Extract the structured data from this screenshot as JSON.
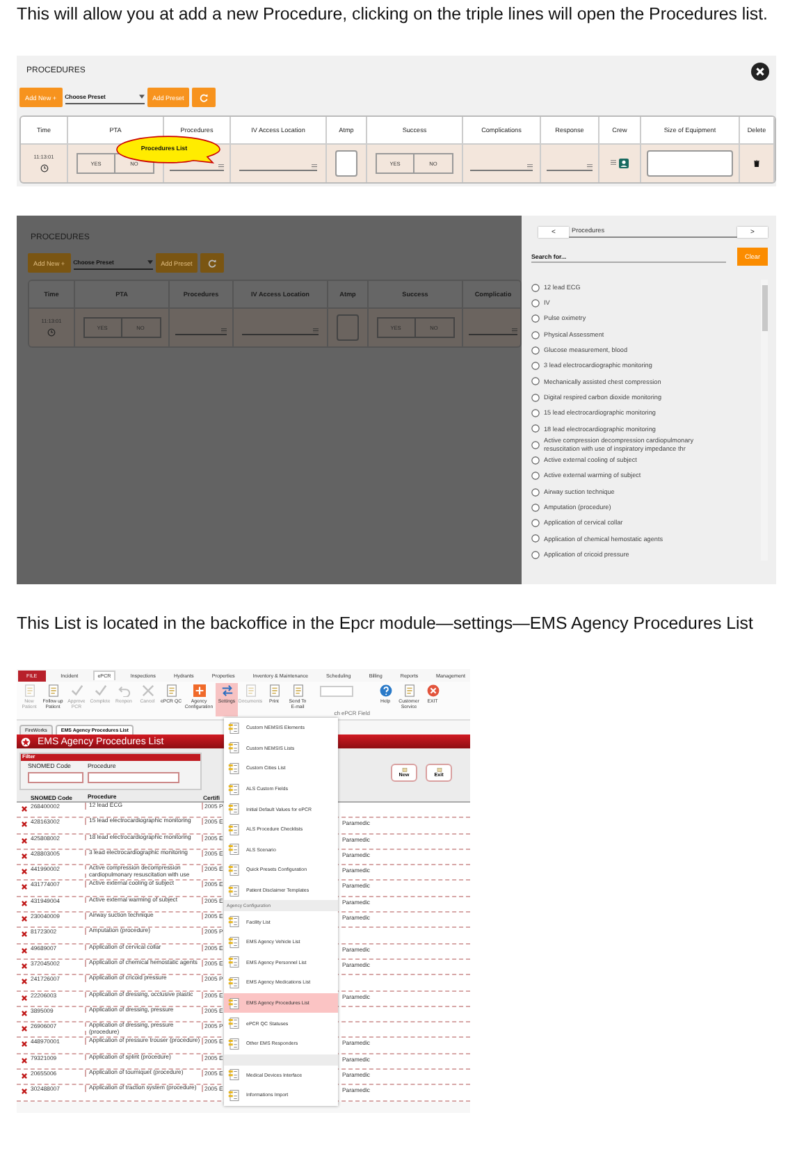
{
  "intro_text": "This will allow you at add a new Procedure, clicking on the triple lines will open the Procedures list.",
  "procedures_form": {
    "title": "PROCEDURES",
    "add_new": "Add New +",
    "preset_placeholder": "Choose Preset",
    "add_preset": "Add Preset",
    "callout": "Procedures List",
    "columns": [
      "Time",
      "PTA",
      "Procedures",
      "IV Access Location",
      "Atmp",
      "Success",
      "Complications",
      "Response",
      "Crew",
      "Size of Equipment",
      "Delete"
    ],
    "row": [
      {
        "kind": "time",
        "text": "11:13:01"
      },
      {
        "kind": "toggle",
        "yes": "YES",
        "no": "NO"
      },
      {
        "kind": "lookup"
      },
      {
        "kind": "lookup"
      },
      {
        "kind": "box"
      },
      {
        "kind": "toggle",
        "yes": "YES",
        "no": "NO"
      },
      {
        "kind": "lookup"
      },
      {
        "kind": "lookup"
      },
      {
        "kind": "crew"
      },
      {
        "kind": "box"
      },
      {
        "kind": "delete"
      }
    ]
  },
  "dimmed_form": {
    "title": "PROCEDURES",
    "add_new": "Add New +",
    "preset_placeholder": "Choose Preset",
    "add_preset": "Add Preset",
    "columns": [
      "Time",
      "PTA",
      "Procedures",
      "IV Access Location",
      "Atmp",
      "Success",
      "Complicatio"
    ],
    "row": [
      {
        "kind": "time",
        "text": "11:13:01"
      },
      {
        "kind": "toggle",
        "yes": "YES",
        "no": "NO"
      },
      {
        "kind": "lookup"
      },
      {
        "kind": "lookup"
      },
      {
        "kind": "box"
      },
      {
        "kind": "toggle",
        "yes": "YES",
        "no": "NO"
      },
      {
        "kind": "lookup"
      }
    ]
  },
  "procedures_picker": {
    "title": "Procedures",
    "prev": "<",
    "next": ">",
    "search_placeholder": "Search for...",
    "clear": "Clear",
    "items": [
      {
        "label": "12 lead ECG",
        "selected": false
      },
      {
        "label": "IV",
        "selected": false
      },
      {
        "label": "Pulse oximetry",
        "selected": false
      },
      {
        "label": "Physical Assessment",
        "selected": false
      },
      {
        "label": "Glucose measurement, blood",
        "selected": false
      },
      {
        "label": "3 lead electrocardiographic monitoring",
        "selected": false
      },
      {
        "label": "Mechanically assisted chest compression",
        "selected": false
      },
      {
        "label": "Digital respired carbon dioxide monitoring",
        "selected": false
      },
      {
        "label": "15 lead electrocardiographic monitoring",
        "selected": false
      },
      {
        "label": "18 lead electrocardiographic monitoring",
        "selected": false
      },
      {
        "label": "Active compression decompression cardiopulmonary resuscitation with use of inspiratory impedance thr",
        "selected": false
      },
      {
        "label": "Active external cooling of subject",
        "selected": false
      },
      {
        "label": "Active external warming of subject",
        "selected": false
      },
      {
        "label": "Airway suction technique",
        "selected": false
      },
      {
        "label": "Amputation (procedure)",
        "selected": false
      },
      {
        "label": "Application of cervical collar",
        "selected": false
      },
      {
        "label": "Application of chemical hemostatic agents",
        "selected": false
      },
      {
        "label": "Application of cricoid pressure",
        "selected": false
      }
    ]
  },
  "location_text": "This List is located in the backoffice in the Epcr module—settings—EMS Agency Procedures List",
  "backoffice": {
    "tabs": [
      {
        "label": "FILE",
        "selected": false
      },
      {
        "label": "Incident",
        "selected": false
      },
      {
        "label": "ePCR",
        "selected": true
      },
      {
        "label": "Inspections",
        "selected": false
      },
      {
        "label": "Hydrants",
        "selected": false
      },
      {
        "label": "Properties",
        "selected": false
      },
      {
        "label": "Inventory & Maintenance",
        "selected": false
      },
      {
        "label": "Scheduling",
        "selected": false
      },
      {
        "label": "Billing",
        "selected": false
      },
      {
        "label": "Reports",
        "selected": false
      },
      {
        "label": "Management",
        "selected": false
      }
    ],
    "ribbon": [
      {
        "kind": "button",
        "label": "New Patient",
        "disabled": true,
        "selected": false
      },
      {
        "kind": "button",
        "label": "Follow up Patient",
        "disabled": false,
        "selected": false
      },
      {
        "kind": "button",
        "label": "Approve PCR",
        "disabled": true,
        "selected": false
      },
      {
        "kind": "button",
        "label": "Complete",
        "disabled": true,
        "selected": false
      },
      {
        "kind": "button",
        "label": "Reopen",
        "disabled": true,
        "selected": false
      },
      {
        "kind": "button",
        "label": "Cancel",
        "disabled": true,
        "selected": false
      },
      {
        "kind": "button",
        "label": "ePCR QC",
        "disabled": false,
        "selected": false
      },
      {
        "kind": "button",
        "label": "Agency Configuration",
        "disabled": false,
        "selected": false
      },
      {
        "kind": "button",
        "label": "Settings",
        "disabled": false,
        "selected": true
      },
      {
        "kind": "button",
        "label": "Documents",
        "disabled": true,
        "selected": false
      },
      {
        "kind": "button",
        "label": "Print",
        "disabled": false,
        "selected": false
      },
      {
        "kind": "button",
        "label": "Send To E-mail",
        "disabled": false,
        "selected": false
      },
      {
        "kind": "field",
        "label": "ch ePCR Field"
      },
      {
        "kind": "button",
        "label": "Help",
        "disabled": false,
        "selected": false
      },
      {
        "kind": "button",
        "label": "Customer Service",
        "disabled": false,
        "selected": false
      },
      {
        "kind": "button",
        "label": "EXIT",
        "disabled": false,
        "selected": false
      }
    ],
    "doc_tabs": [
      {
        "label": "FireWorks",
        "selected": false
      },
      {
        "label": "EMS Agency Procedures List",
        "selected": true
      }
    ],
    "title": "EMS Agency Procedures List",
    "filter": {
      "title": "Filter",
      "fields": [
        "SNOMED Code",
        "Procedure"
      ]
    },
    "buttons": [
      "New",
      "Exit"
    ],
    "columns": [
      "SNOMED Code",
      "Procedure",
      "Certifi"
    ],
    "rows": [
      {
        "code": "268400002",
        "procedure": "12 lead ECG",
        "cert": "2005 P",
        "level": ""
      },
      {
        "code": "428163002",
        "procedure": "15 lead electrocardiographic monitoring",
        "cert": "2005 E",
        "level": "Paramedic"
      },
      {
        "code": "425808002",
        "procedure": "18 lead electrocardiographic monitoring",
        "cert": "2005 E",
        "level": "Paramedic"
      },
      {
        "code": "428803005",
        "procedure": "3 lead electrocardiographic monitoring",
        "cert": "2005 E",
        "level": "Paramedic"
      },
      {
        "code": "441990002",
        "procedure": "Active compression decompression cardiopulmonary resuscitation with use",
        "cert": "2005 E",
        "level": "Paramedic"
      },
      {
        "code": "431774007",
        "procedure": "Active external cooling of subject",
        "cert": "2005 E",
        "level": "Paramedic"
      },
      {
        "code": "431949004",
        "procedure": "Active external warming of subject",
        "cert": "2005 E",
        "level": "Paramedic"
      },
      {
        "code": "230040009",
        "procedure": "Airway suction technique",
        "cert": "2005 E",
        "level": "Paramedic"
      },
      {
        "code": "81723002",
        "procedure": "Amputation (procedure)",
        "cert": "2005 P",
        "level": ""
      },
      {
        "code": "49689007",
        "procedure": "Application of cervical collar",
        "cert": "2005 E",
        "level": "Paramedic"
      },
      {
        "code": "372045002",
        "procedure": "Application of chemical hemostatic agents",
        "cert": "2005 E",
        "level": "Paramedic"
      },
      {
        "code": "241726007",
        "procedure": "Application of cricoid pressure",
        "cert": "2005 P",
        "level": ""
      },
      {
        "code": "22206003",
        "procedure": "Application of dressing, occlusive plastic",
        "cert": "2005 E",
        "level": "Paramedic"
      },
      {
        "code": "3895009",
        "procedure": "Application of dressing, pressure",
        "cert": "2005 E",
        "level": ""
      },
      {
        "code": "26906007",
        "procedure": "Application of dressing, pressure (procedure)",
        "cert": "2005 P",
        "level": ""
      },
      {
        "code": "448970001",
        "procedure": "Application of pressure trouser (procedure)",
        "cert": "2005 E",
        "level": "Paramedic"
      },
      {
        "code": "79321009",
        "procedure": "Application of splint (procedure)",
        "cert": "2005 E",
        "level": "Paramedic"
      },
      {
        "code": "20655006",
        "procedure": "Application of tourniquet (procedure)",
        "cert": "2005 E",
        "level": "Paramedic"
      },
      {
        "code": "302488007",
        "procedure": "Application of traction system (procedure)",
        "cert": "2005 E",
        "level": "Paramedic"
      }
    ],
    "menu": [
      {
        "kind": "item",
        "label": "Custom NEMSIS Elements",
        "selected": false
      },
      {
        "kind": "item",
        "label": "Custom NEMSIS Lists",
        "selected": false
      },
      {
        "kind": "item",
        "label": "Custom Cities List",
        "selected": false
      },
      {
        "kind": "item",
        "label": "ALS Custom Fields",
        "selected": false
      },
      {
        "kind": "item",
        "label": "Initial Default Values for ePCR",
        "selected": false
      },
      {
        "kind": "item",
        "label": "ALS Procedure Checklists",
        "selected": false
      },
      {
        "kind": "item",
        "label": "ALS Scenario",
        "selected": false
      },
      {
        "kind": "item",
        "label": "Quick Presets Configuration",
        "selected": false
      },
      {
        "kind": "item",
        "label": "Patient Disclaimer Templates",
        "selected": false
      },
      {
        "kind": "section",
        "label": "Agency Configuration"
      },
      {
        "kind": "item",
        "label": "Facility List",
        "selected": false
      },
      {
        "kind": "item",
        "label": "EMS Agency Vehicle List",
        "selected": false
      },
      {
        "kind": "item",
        "label": "EMS Agency Personnel List",
        "selected": false
      },
      {
        "kind": "item",
        "label": "EMS Agency Medications List",
        "selected": false
      },
      {
        "kind": "item",
        "label": "EMS Agency Procedures List",
        "selected": true
      },
      {
        "kind": "item",
        "label": "ePCR QC Statuses",
        "selected": false
      },
      {
        "kind": "item",
        "label": "Other EMS Responders",
        "selected": false
      },
      {
        "kind": "section"
      },
      {
        "kind": "item",
        "label": "Medical Devices Interface",
        "selected": false
      },
      {
        "kind": "item",
        "label": "Informations Import",
        "selected": false
      }
    ]
  }
}
